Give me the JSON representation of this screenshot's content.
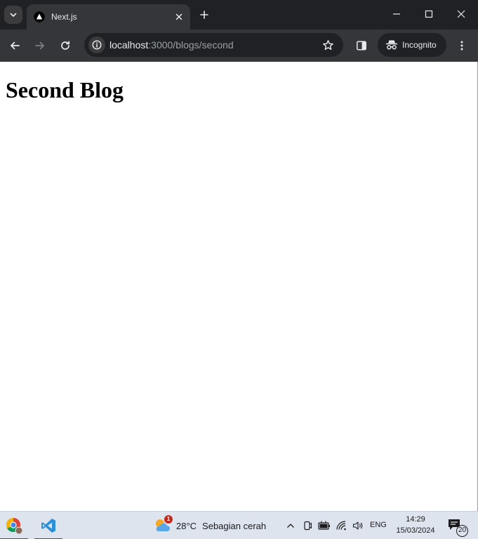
{
  "browser": {
    "tab": {
      "title": "Next.js"
    },
    "address_bar": {
      "host": "localhost",
      "path": ":3000/blogs/second"
    },
    "profile": {
      "label": "Incognito"
    }
  },
  "page": {
    "heading": "Second Blog"
  },
  "taskbar": {
    "weather": {
      "badge": "1",
      "temperature": "28°C",
      "description": "Sebagian cerah"
    },
    "language": "ENG",
    "clock": {
      "time": "14:29",
      "date": "15/03/2024"
    },
    "notifications": {
      "count": "20"
    }
  },
  "colors": {
    "titlebar": "#202124",
    "toolbar": "#35363a",
    "taskbar": "#dde4ee",
    "accent": "#0067c0"
  }
}
